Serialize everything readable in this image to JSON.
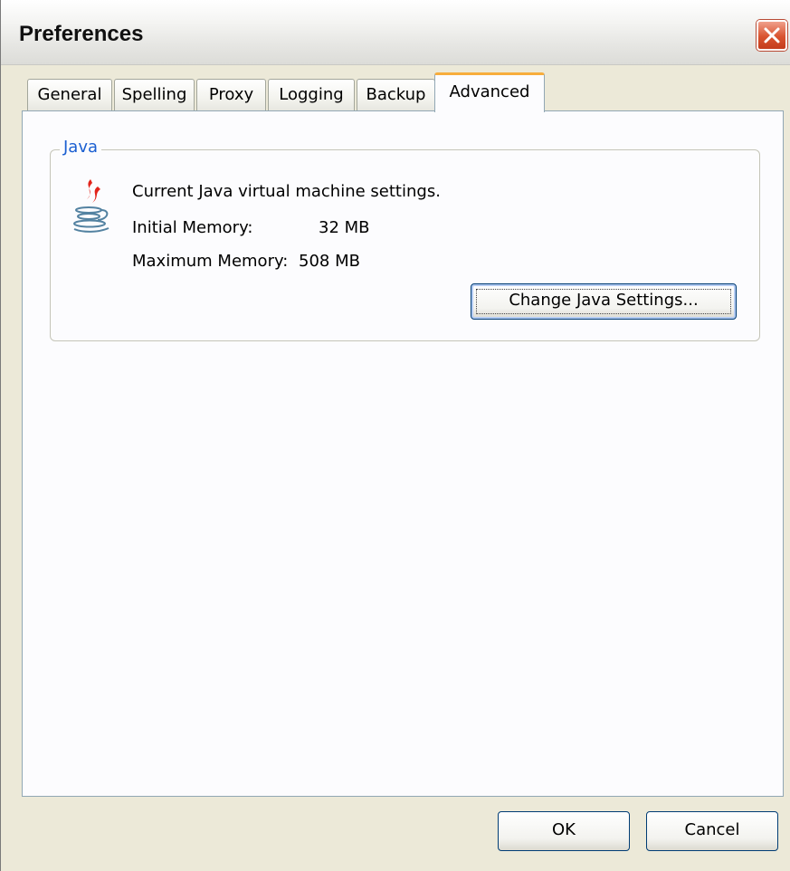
{
  "window": {
    "title": "Preferences",
    "close_icon": "close-icon"
  },
  "tabs": [
    {
      "label": "General",
      "active": false
    },
    {
      "label": "Spelling",
      "active": false
    },
    {
      "label": "Proxy",
      "active": false
    },
    {
      "label": "Logging",
      "active": false
    },
    {
      "label": "Backup",
      "active": false
    },
    {
      "label": "Advanced",
      "active": true
    }
  ],
  "java_group": {
    "legend": "Java",
    "icon": "java-icon",
    "description": "Current Java virtual machine settings.",
    "initial_memory_label": "Initial Memory:",
    "initial_memory_value": "32 MB",
    "maximum_memory_label": "Maximum Memory:",
    "maximum_memory_value": "508 MB",
    "change_button": "Change Java Settings..."
  },
  "footer": {
    "ok_label": "OK",
    "cancel_label": "Cancel"
  },
  "colors": {
    "legend_blue": "#1b5fd1",
    "active_tab_accent": "#f7ad3c",
    "close_red": "#d9542f"
  }
}
